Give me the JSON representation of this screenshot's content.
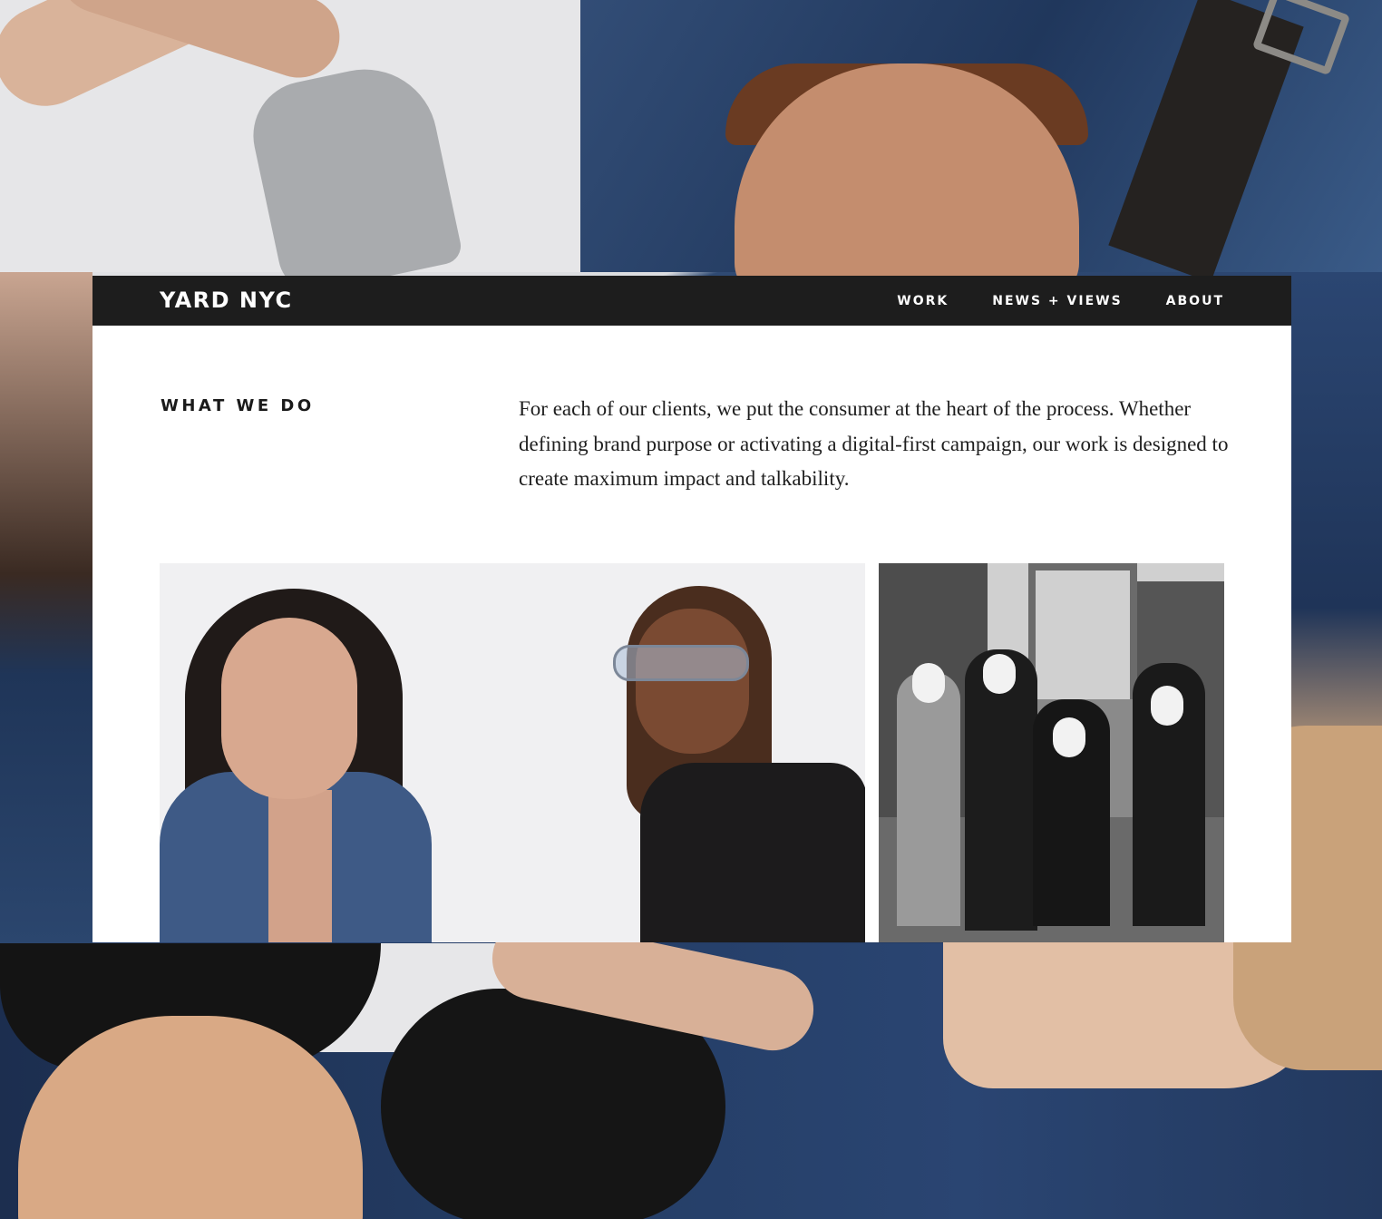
{
  "site": {
    "logo": "YARD NYC",
    "nav": [
      {
        "label": "WORK"
      },
      {
        "label": "NEWS + VIEWS"
      },
      {
        "label": "ABOUT"
      }
    ]
  },
  "section": {
    "label": "WHAT WE DO",
    "body": "For each of our clients, we put the consumer at the heart of the process. Whether defining brand purpose or activating a digital-first campaign, our work is designed to create maximum impact and talkability."
  },
  "colors": {
    "topbar": "#1d1d1d",
    "card": "#ffffff",
    "text": "#1e1e1e"
  }
}
